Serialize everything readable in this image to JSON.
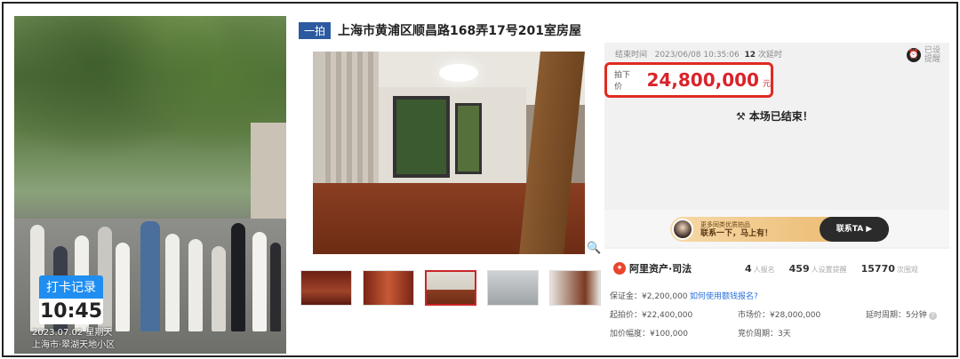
{
  "photo": {
    "punch_label": "打卡记录",
    "punch_time": "10:45",
    "date_line": "2023.07.02 星期天",
    "location_line": "上海市·翠湖天地小区"
  },
  "listing": {
    "tag": "一拍",
    "title": "上海市黄浦区顺昌路168弄17号201室房屋"
  },
  "auction": {
    "end_label": "结束时间",
    "end_time": "2023/06/08 10:35:06",
    "delays": "12",
    "delays_label": "次延时",
    "remind_label": "已设\n提醒",
    "price_label": "拍下价",
    "price_value": "24,800,000",
    "price_unit": "元",
    "ended_text": "本场已结束！"
  },
  "promo": {
    "line1": "更多同类优质拍品",
    "line2": "联系一下，马上有！",
    "button": "联系TA ▶"
  },
  "stats": {
    "brand": "阿里资产·司法",
    "signups": "4",
    "signups_label": "人报名",
    "reminders": "459",
    "reminders_label": "人设置提醒",
    "views": "15770",
    "views_label": "次围观"
  },
  "details": {
    "deposit": "保证金：¥2,200,000",
    "deposit_link": "如何使用额钱报名?",
    "start_price": "起拍价：¥22,400,000",
    "market_price": "市场价：¥28,000,000",
    "delay_period": "延时周期：5分钟",
    "increment": "加价幅度：¥100,000",
    "bid_period": "竞价周期：3天"
  },
  "icons": {
    "alarm": "alarm-clock-icon",
    "gavel": "gavel-icon",
    "zoom": "zoom-icon",
    "help": "help-icon"
  },
  "colors": {
    "price_red": "#d9232a",
    "highlight_border": "#e02b20",
    "tag_blue": "#2c5aa0",
    "punch_blue": "#1f8ef0"
  }
}
